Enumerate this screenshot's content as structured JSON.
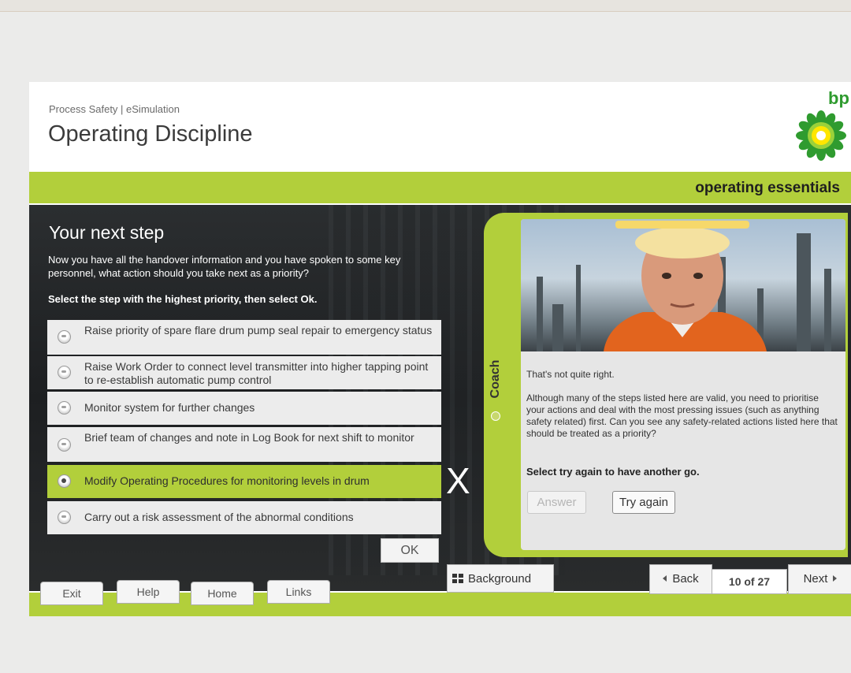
{
  "header": {
    "subtitle": "Process Safety | eSimulation",
    "title": "Operating Discipline",
    "logo_text": "bp",
    "brand_strip": "operating essentials"
  },
  "question": {
    "title": "Your next step",
    "text": "Now you have all the handover information and you have spoken to some key personnel, what action should you take next as a priority?",
    "instruction": "Select the step with the highest priority, then select Ok.",
    "options": [
      {
        "label": "Raise priority of spare flare drum pump seal repair to emergency status",
        "selected": false
      },
      {
        "label": "Raise Work Order to connect level transmitter into higher tapping point to re-establish automatic pump control",
        "selected": false
      },
      {
        "label": "Monitor system for further changes",
        "selected": false
      },
      {
        "label": "Brief team of changes and note in Log Book for next shift to monitor",
        "selected": false
      },
      {
        "label": "Modify Operating Procedures for monitoring levels in drum",
        "selected": true
      },
      {
        "label": "Carry out a risk assessment of the abnormal conditions",
        "selected": false
      }
    ],
    "ok_label": "OK",
    "result_mark": "X"
  },
  "coach": {
    "tab_label": "Coach",
    "feedback_short": "That's not quite right.",
    "feedback_text": "Although many of the steps listed here are valid, you need to prioritise your actions and deal with the most pressing issues (such as anything safety related) first. Can you see any safety-related actions listed here that should be treated as a priority?",
    "instruction": "Select try again to have another go.",
    "answer_label": "Answer",
    "try_again_label": "Try again"
  },
  "footer": {
    "exit": "Exit",
    "help": "Help",
    "home": "Home",
    "links": "Links",
    "background": "Background",
    "back": "Back",
    "page_counter": "10 of 27",
    "next": "Next"
  },
  "colors": {
    "accent_green": "#b2cf3b",
    "panel_dark": "#25282a",
    "bp_green": "#2f9b2f",
    "bp_yellow": "#ffe600"
  },
  "icons": {
    "radio": "radio-button-icon",
    "background": "grid-icon",
    "back": "triangle-left-icon",
    "next": "triangle-right-icon",
    "result": "cross-icon"
  }
}
